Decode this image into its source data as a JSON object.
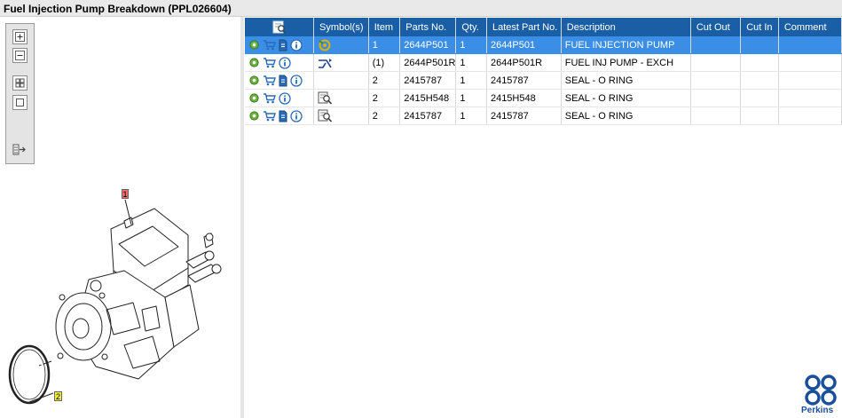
{
  "window": {
    "title": "Fuel Injection Pump Breakdown (PPL026604)"
  },
  "toolbar": {
    "buttons": [
      {
        "name": "zoom-in-icon"
      },
      {
        "name": "zoom-out-icon"
      },
      {
        "name": "fit-all-icon"
      },
      {
        "name": "fit-window-icon"
      },
      {
        "name": "export-icon"
      }
    ]
  },
  "callouts": [
    "1",
    "2"
  ],
  "table": {
    "columns": [
      "Symbol(s)",
      "Item",
      "Parts No.",
      "Qty.",
      "Latest Part No.",
      "Description",
      "Cut Out",
      "Cut In",
      "Comment"
    ],
    "rows": [
      {
        "selected": true,
        "symbol": "assembly-symbol-icon",
        "item": "1",
        "parts_no": "2644P501",
        "qty": "1",
        "latest": "2644P501",
        "description": "FUEL INJECTION PUMP",
        "cut_out": "",
        "cut_in": "",
        "comment": "",
        "has_doc": true
      },
      {
        "selected": false,
        "symbol": "exchange-symbol-icon",
        "item": "(1)",
        "parts_no": "2644P501R",
        "qty": "1",
        "latest": "2644P501R",
        "description": "FUEL INJ PUMP - EXCH",
        "cut_out": "",
        "cut_in": "",
        "comment": "",
        "has_doc": false
      },
      {
        "selected": false,
        "symbol": "",
        "item": "2",
        "parts_no": "2415787",
        "qty": "1",
        "latest": "2415787",
        "description": "SEAL - O RING",
        "cut_out": "",
        "cut_in": "",
        "comment": "",
        "has_doc": true
      },
      {
        "selected": false,
        "symbol": "detail-view-symbol-icon",
        "item": "2",
        "parts_no": "2415H548",
        "qty": "1",
        "latest": "2415H548",
        "description": "SEAL - O RING",
        "cut_out": "",
        "cut_in": "",
        "comment": "",
        "has_doc": false
      },
      {
        "selected": false,
        "symbol": "detail-view-symbol-icon",
        "item": "2",
        "parts_no": "2415787",
        "qty": "1",
        "latest": "2415787",
        "description": "SEAL - O RING",
        "cut_out": "",
        "cut_in": "",
        "comment": "",
        "has_doc": true
      }
    ]
  },
  "brand": {
    "name": "Perkins",
    "color": "#1a4f9c"
  },
  "colors": {
    "header": "#1a5fa5",
    "selected_row": "#3a8ee6",
    "callout_1": "#f26b6b",
    "callout_2": "#f4f03a"
  }
}
